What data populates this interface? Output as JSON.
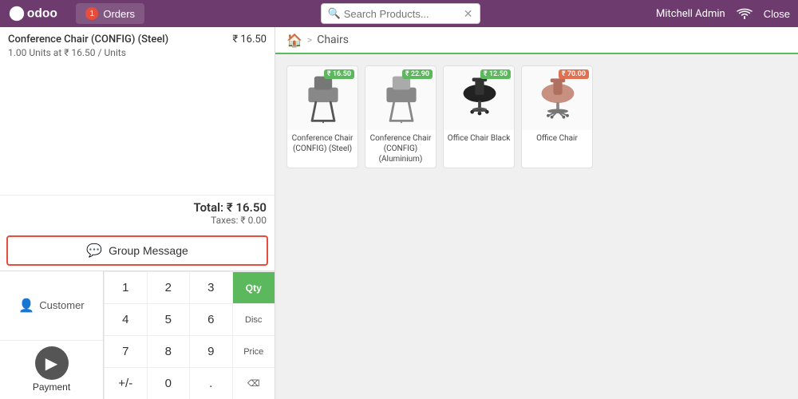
{
  "header": {
    "logo_text": "odoo",
    "orders_label": "Orders",
    "orders_badge": "1",
    "search_placeholder": "Search Products...",
    "user_name": "Mitchell Admin",
    "close_label": "Close"
  },
  "breadcrumb": {
    "home_icon": "🏠",
    "separator": ">",
    "current": "Chairs"
  },
  "order": {
    "item_name": "Conference Chair (CONFIG) (Steel)",
    "item_price": "₹ 16.50",
    "item_qty": "1.00 Units at ₹ 16.50 / Units",
    "total_label": "Total: ₹ 16.50",
    "taxes_label": "Taxes: ₹ 0.00"
  },
  "group_message": {
    "label": "Group Message"
  },
  "numpad": {
    "customer_label": "Customer",
    "payment_label": "Payment",
    "keys": [
      "1",
      "2",
      "3",
      "4",
      "5",
      "6",
      "7",
      "8",
      "9",
      "+/-",
      "0",
      "."
    ],
    "actions": [
      "Qty",
      "Disc",
      "Price",
      "⌫"
    ]
  },
  "products": [
    {
      "name": "Conference Chair (CONFIG) (Steel)",
      "price": "₹ 16.50",
      "badge": "₹ 16.50",
      "color": "#555"
    },
    {
      "name": "Conference Chair (CONFIG) (Aluminium)",
      "price": "₹ 22.90",
      "badge": "₹ 22.90",
      "color": "#555"
    },
    {
      "name": "Office Chair Black",
      "price": "₹ 12.50",
      "badge": "₹ 12.50",
      "color": "#333"
    },
    {
      "name": "Office Chair",
      "price": "₹ 70.00",
      "badge": "₹ 70.00",
      "color": "#b07050"
    }
  ]
}
